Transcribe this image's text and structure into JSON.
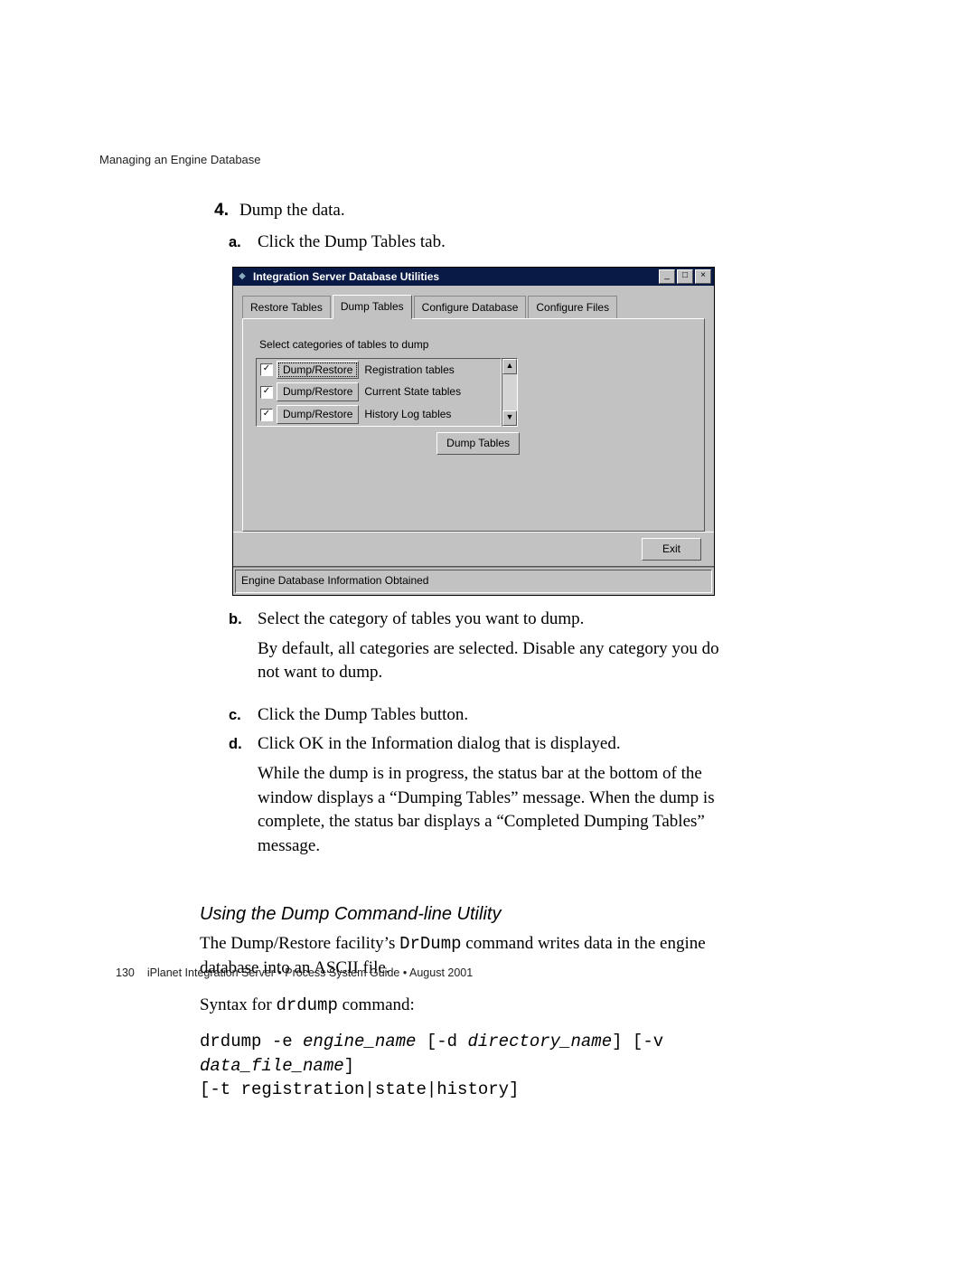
{
  "running_head": "Managing an Engine Database",
  "step": {
    "num": "4.",
    "text": "Dump the data.",
    "a": {
      "label": "a.",
      "text": "Click the Dump Tables tab."
    },
    "b": {
      "label": "b.",
      "text": "Select the category of tables you want to dump.",
      "para": "By default, all categories are selected. Disable any category you do not want to dump."
    },
    "c": {
      "label": "c.",
      "text": "Click the Dump Tables button."
    },
    "d": {
      "label": "d.",
      "text": "Click OK in the Information dialog that is displayed.",
      "para": "While the dump is in progress, the status bar at the bottom of the window displays a “Dumping Tables” message. When the dump is complete, the status bar displays a “Completed Dumping Tables” message."
    }
  },
  "section_heading": "Using the Dump Command-line Utility",
  "section_para_pre": "The Dump/Restore facility’s ",
  "section_para_code": "DrDump",
  "section_para_post": " command writes data in the engine database into an ASCII file.",
  "syntax_pre": "Syntax for ",
  "syntax_code": "drdump",
  "syntax_post": " command:",
  "cmd": {
    "l1_a": "drdump -e ",
    "l1_b": "engine_name",
    "l1_c": " [-d ",
    "l1_d": "directory_name",
    "l1_e": "] [-v ",
    "l1_f": "data_file_name",
    "l1_g": "]",
    "l2": "[-t registration|state|history]"
  },
  "footer": {
    "page": "130",
    "text": "iPlanet Integration Server • Process System Guide • August 2001"
  },
  "dialog": {
    "title": "Integration Server Database Utilities",
    "tabs": [
      "Restore Tables",
      "Dump Tables",
      "Configure Database",
      "Configure Files"
    ],
    "panel_label": "Select categories of tables to dump",
    "rows": [
      {
        "checked": true,
        "btn": "Dump/Restore",
        "text": "Registration tables"
      },
      {
        "checked": true,
        "btn": "Dump/Restore",
        "text": "Current State tables"
      },
      {
        "checked": true,
        "btn": "Dump/Restore",
        "text": "History Log tables"
      }
    ],
    "dump_btn": "Dump Tables",
    "exit_btn": "Exit",
    "status": "Engine Database Information Obtained"
  }
}
